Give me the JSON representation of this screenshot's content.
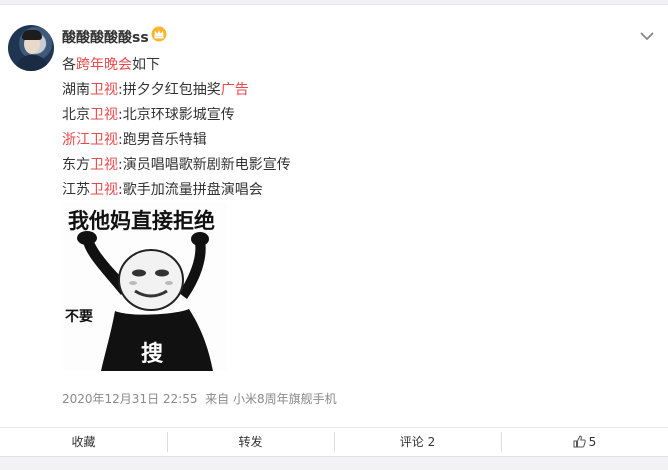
{
  "user": {
    "name": "酸酸酸酸酸ss",
    "badge_icon": "crown-icon"
  },
  "post": {
    "lines": [
      {
        "parts": [
          "各",
          "跨年晚会",
          "如下"
        ],
        "highlight": [
          false,
          true,
          false
        ]
      },
      {
        "parts": [
          "湖南",
          "卫视",
          ":拼夕夕红包抽奖",
          "广告"
        ],
        "highlight": [
          false,
          true,
          false,
          true
        ]
      },
      {
        "parts": [
          "北京",
          "卫视",
          ":北京环球影城宣传"
        ],
        "highlight": [
          false,
          true,
          false
        ]
      },
      {
        "parts": [
          "浙江卫视",
          ":跑男音乐特辑"
        ],
        "highlight": [
          true,
          false
        ]
      },
      {
        "parts": [
          "东方",
          "卫视",
          ":演员唱唱歌新剧新电影宣传"
        ],
        "highlight": [
          false,
          true,
          false
        ]
      },
      {
        "parts": [
          "江苏",
          "卫视",
          ":歌手加流量拼盘演唱会"
        ],
        "highlight": [
          false,
          true,
          false
        ]
      }
    ],
    "highlight_color": "#eb4a4b",
    "image": {
      "top_text": "我他妈直接拒绝",
      "side_text": "不要",
      "center_text": "搜"
    }
  },
  "meta": {
    "timestamp": "2020年12月31日 22:55",
    "source": "来自 小米8周年旗舰手机"
  },
  "actions": {
    "favorite": "收藏",
    "repost": "转发",
    "comment": "评论 2",
    "like_count": "5"
  }
}
